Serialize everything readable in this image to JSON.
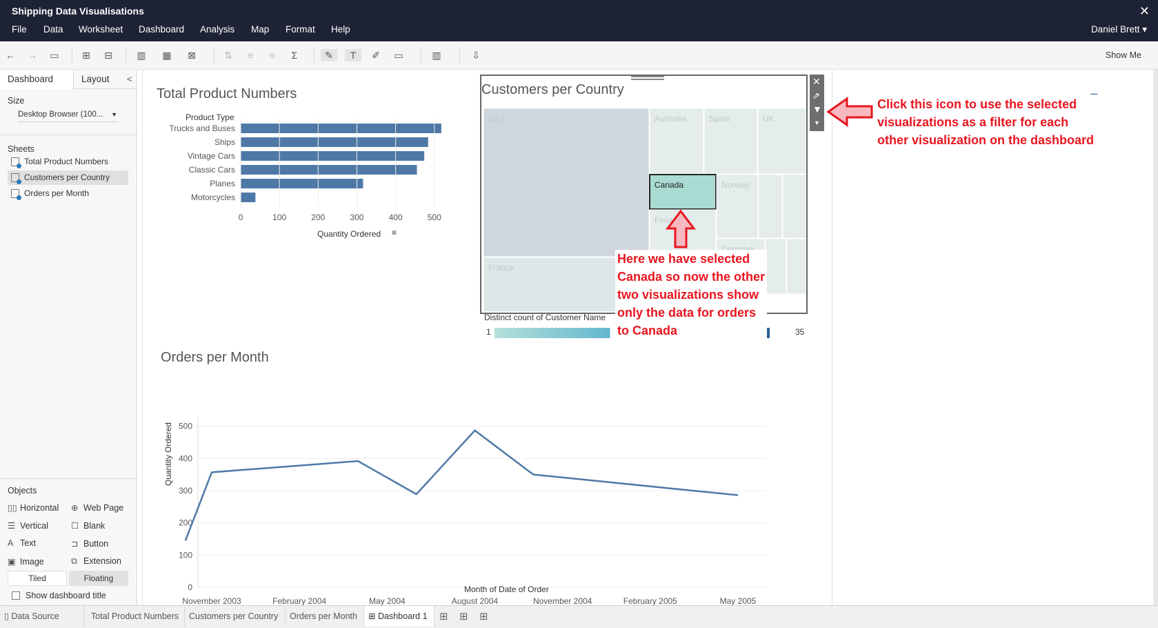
{
  "window": {
    "title": "Shipping Data Visualisations",
    "user": "Daniel Brett ▾",
    "close": "✕"
  },
  "menu": [
    "File",
    "Data",
    "Worksheet",
    "Dashboard",
    "Analysis",
    "Map",
    "Format",
    "Help"
  ],
  "toolbar": {
    "show_me": "Show Me"
  },
  "leftpane": {
    "tabs": [
      "Dashboard",
      "Layout"
    ],
    "collapse": "<",
    "size_label": "Size",
    "size_value": "Desktop Browser (100...",
    "sheets_label": "Sheets",
    "sheets": [
      "Total Product Numbers",
      "Customers per Country",
      "Orders per Month"
    ],
    "selected_sheet": 1,
    "objects_label": "Objects",
    "objects": [
      {
        "label": "Horizontal",
        "icon": "horizontal-container-icon",
        "glyph": "▯▯"
      },
      {
        "label": "Web Page",
        "icon": "globe-icon",
        "glyph": "⊕"
      },
      {
        "label": "Vertical",
        "icon": "vertical-container-icon",
        "glyph": "☰"
      },
      {
        "label": "Blank",
        "icon": "blank-icon",
        "glyph": "☐"
      },
      {
        "label": "Text",
        "icon": "text-icon",
        "glyph": "A"
      },
      {
        "label": "Button",
        "icon": "button-icon",
        "glyph": "⊐"
      },
      {
        "label": "Image",
        "icon": "image-icon",
        "glyph": "▣"
      },
      {
        "label": "Extension",
        "icon": "extension-icon",
        "glyph": "⧉"
      }
    ],
    "tiled": "Tiled",
    "floating": "Floating",
    "show_title": "Show dashboard title"
  },
  "bottom_tabs": [
    "Data Source",
    "Total Product Numbers",
    "Customers per Country",
    "Orders per Month",
    "Dashboard 1"
  ],
  "active_bottom_tab": 4,
  "chart_data": [
    {
      "type": "bar",
      "title": "Total Product Numbers",
      "category_header": "Product Type",
      "categories": [
        "Trucks and Buses",
        "Ships",
        "Vintage Cars",
        "Classic Cars",
        "Planes",
        "Motorcycles"
      ],
      "values": [
        518,
        484,
        474,
        455,
        316,
        38
      ],
      "xlabel": "Quantity Ordered",
      "xlim": [
        0,
        520
      ],
      "xticks": [
        0,
        100,
        200,
        300,
        400,
        500
      ],
      "color": "#4e79a7"
    },
    {
      "type": "heatmap",
      "title": "Customers per Country",
      "cells": [
        "USA",
        "Australia",
        "Spain",
        "UK",
        "Canada",
        "Norway",
        "Finland",
        "Denmark",
        "France"
      ],
      "selected": "Canada",
      "legend_title": "Distinct count of Customer Name",
      "legend_min": 1,
      "legend_max": 35,
      "colors": {
        "low": "#b5e0d9",
        "mid": "#63b7cf",
        "high": "#2e5f8f"
      }
    },
    {
      "type": "line",
      "title": "Orders per Month",
      "x": [
        "2003-10",
        "2003-11",
        "2004-04",
        "2004-06",
        "2004-08",
        "2004-10",
        "2005-05"
      ],
      "y": [
        145,
        357,
        392,
        289,
        487,
        350,
        286
      ],
      "xticks": [
        "November 2003",
        "February 2004",
        "May 2004",
        "August 2004",
        "November 2004",
        "February 2005",
        "May 2005"
      ],
      "yticks": [
        0,
        100,
        200,
        300,
        400,
        500
      ],
      "ylim": [
        0,
        510
      ],
      "xlabel": "Month of Date of Order",
      "ylabel": "Quantity Ordered",
      "color": "#4e79a7"
    }
  ],
  "annotations": {
    "filter_note": "Click this icon to use the selected visualizations as a filter for each other visualization on the dashboard",
    "canada_note": "Here we have selected Canada so now the other two visualizations show only the data for orders to Canada"
  }
}
